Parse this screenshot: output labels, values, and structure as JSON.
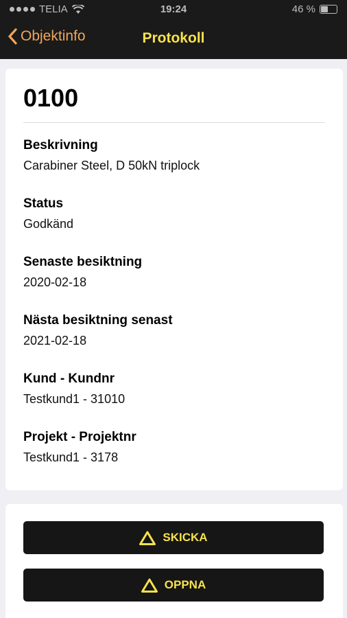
{
  "status_bar": {
    "carrier": "TELIA",
    "time": "19:24",
    "battery": "46 %"
  },
  "nav": {
    "back_label": "Objektinfo",
    "title": "Protokoll"
  },
  "object": {
    "number": "0100",
    "fields": [
      {
        "label": "Beskrivning",
        "value": "Carabiner Steel, D 50kN triplock"
      },
      {
        "label": "Status",
        "value": "Godkänd"
      },
      {
        "label": "Senaste besiktning",
        "value": "2020-02-18"
      },
      {
        "label": "Nästa besiktning senast",
        "value": "2021-02-18"
      },
      {
        "label": "Kund - Kundnr",
        "value": "Testkund1 - 31010"
      },
      {
        "label": "Projekt - Projektnr",
        "value": "Testkund1 - 3178"
      }
    ]
  },
  "actions": {
    "send_label": "SKICKA",
    "open_label": "OPPNA"
  },
  "colors": {
    "accent_yellow": "#f7e34a",
    "back_orange": "#f0a65a",
    "bar_dark": "#1a1a1a"
  },
  "icons": [
    "wifi-icon",
    "battery-icon",
    "back-chevron-icon",
    "warning-triangle-icon"
  ]
}
